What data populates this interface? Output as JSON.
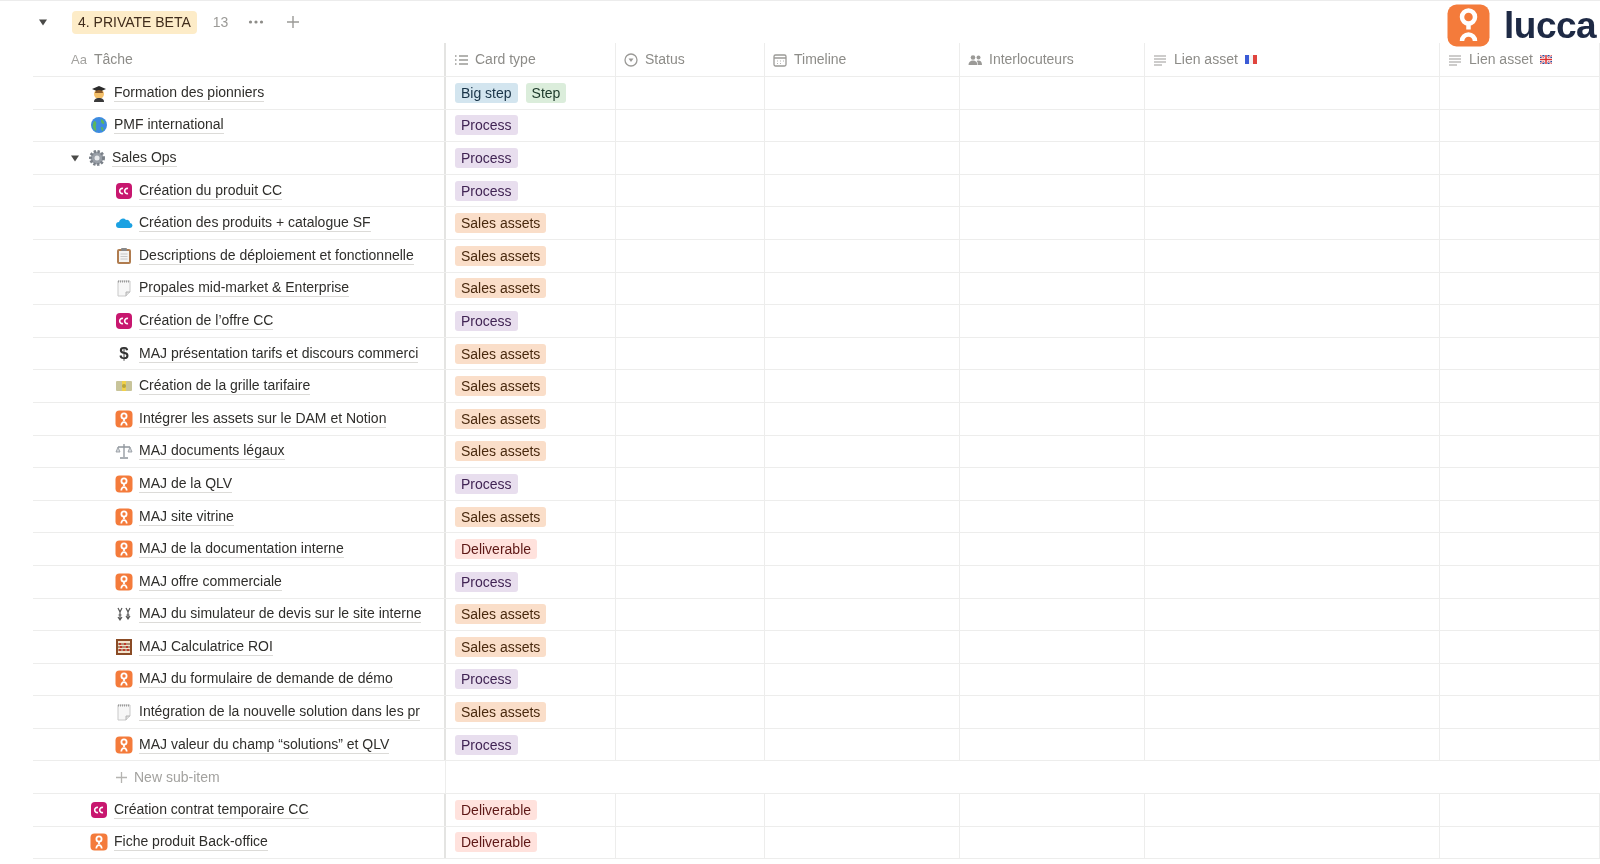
{
  "group": {
    "expanded": true,
    "label": "4. PRIVATE BETA",
    "count": "13"
  },
  "logo": {
    "text": "lucca"
  },
  "columns": [
    {
      "kind": "title",
      "icon_text": "Aa",
      "label": "Tâche"
    },
    {
      "kind": "select",
      "label": "Card type"
    },
    {
      "kind": "status",
      "label": "Status"
    },
    {
      "kind": "date",
      "label": "Timeline"
    },
    {
      "kind": "person",
      "label": "Interlocuteurs"
    },
    {
      "kind": "text",
      "label": "Lien asset",
      "flag": {
        "kind": "fr"
      }
    },
    {
      "kind": "text",
      "label": "Lien asset",
      "flag": {
        "kind": "uk"
      }
    }
  ],
  "rows": [
    {
      "kind": "graduate",
      "title": "Formation des pionniers",
      "card_type": [
        {
          "label": "Big step",
          "color": "#d3e5ef"
        },
        {
          "label": "Step",
          "color": "#dbeddb"
        }
      ]
    },
    {
      "kind": "globe",
      "title": "PMF international",
      "card_type": [
        {
          "label": "Process",
          "color": "#e8deee"
        }
      ]
    },
    {
      "kind": "gear",
      "title": "Sales Ops",
      "expanded": true,
      "card_type": [
        {
          "label": "Process",
          "color": "#e8deee"
        }
      ],
      "new_sub_item": "New sub-item",
      "children": [
        {
          "kind": "cc",
          "title": "Création du produit CC",
          "card_type": [
            {
              "label": "Process",
              "color": "#e8deee"
            }
          ]
        },
        {
          "kind": "cloud",
          "title": "Création des produits + catalogue SF",
          "card_type": [
            {
              "label": "Sales assets",
              "color": "#fadec9"
            }
          ]
        },
        {
          "kind": "clipboard",
          "title": "Descriptions de déploiement et fonctionnelle",
          "card_type": [
            {
              "label": "Sales assets",
              "color": "#fadec9"
            }
          ]
        },
        {
          "kind": "notepad",
          "title": "Propales mid-market & Enterprise",
          "card_type": [
            {
              "label": "Sales assets",
              "color": "#fadec9"
            }
          ]
        },
        {
          "kind": "cc",
          "title": "Création de l’offre CC",
          "card_type": [
            {
              "label": "Process",
              "color": "#e8deee"
            }
          ]
        },
        {
          "kind": "glyph",
          "glyph": "$",
          "title": "MAJ présentation tarifs et discours commerci",
          "card_type": [
            {
              "label": "Sales assets",
              "color": "#fadec9"
            }
          ]
        },
        {
          "kind": "banknote",
          "title": "Création de la grille tarifaire",
          "card_type": [
            {
              "label": "Sales assets",
              "color": "#fadec9"
            }
          ]
        },
        {
          "kind": "orange",
          "title": "Intégrer les assets sur le DAM et Notion",
          "card_type": [
            {
              "label": "Sales assets",
              "color": "#fadec9"
            }
          ]
        },
        {
          "kind": "scales",
          "title": "MAJ documents légaux",
          "card_type": [
            {
              "label": "Sales assets",
              "color": "#fadec9"
            }
          ]
        },
        {
          "kind": "orange",
          "title": "MAJ de la QLV",
          "card_type": [
            {
              "label": "Process",
              "color": "#e8deee"
            }
          ]
        },
        {
          "kind": "orange",
          "title": "MAJ site vitrine",
          "card_type": [
            {
              "label": "Sales assets",
              "color": "#fadec9"
            }
          ]
        },
        {
          "kind": "orange",
          "title": "MAJ de la documentation interne",
          "card_type": [
            {
              "label": "Deliverable",
              "color": "#ffe2dd"
            }
          ]
        },
        {
          "kind": "orange",
          "title": "MAJ offre commerciale",
          "card_type": [
            {
              "label": "Process",
              "color": "#e8deee"
            }
          ]
        },
        {
          "kind": "exchange",
          "title": "MAJ du simulateur de devis sur le site interne",
          "card_type": [
            {
              "label": "Sales assets",
              "color": "#fadec9"
            }
          ]
        },
        {
          "kind": "abacus",
          "title": "MAJ Calculatrice ROI",
          "card_type": [
            {
              "label": "Sales assets",
              "color": "#fadec9"
            }
          ]
        },
        {
          "kind": "orange",
          "title": "MAJ du formulaire de demande de démo",
          "card_type": [
            {
              "label": "Process",
              "color": "#e8deee"
            }
          ]
        },
        {
          "kind": "notepad",
          "title": "Intégration de la nouvelle solution dans les pr",
          "card_type": [
            {
              "label": "Sales assets",
              "color": "#fadec9"
            }
          ]
        },
        {
          "kind": "orange",
          "title": "MAJ valeur du champ “solutions” et QLV",
          "card_type": [
            {
              "label": "Process",
              "color": "#e8deee"
            }
          ]
        }
      ]
    },
    {
      "kind": "cc",
      "title": "Création contrat temporaire CC",
      "card_type": [
        {
          "label": "Deliverable",
          "color": "#ffe2dd"
        }
      ]
    },
    {
      "kind": "orange",
      "title": "Fiche produit Back-office",
      "card_type": [
        {
          "label": "Deliverable",
          "color": "#ffe2dd"
        }
      ]
    }
  ]
}
